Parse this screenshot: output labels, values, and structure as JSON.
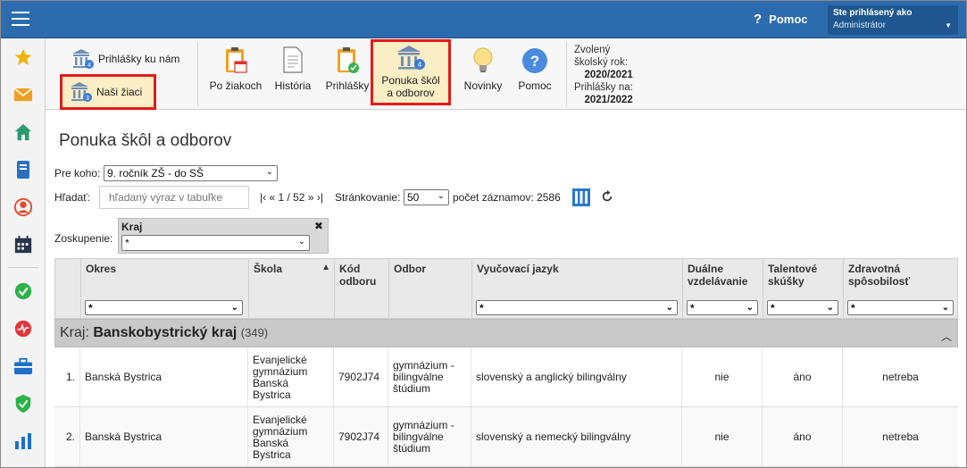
{
  "topbar": {
    "help_label": "Pomoc",
    "user_line1": "Ste prihlásený ako",
    "user_line2": "Administrátor",
    "bar_color": "#2c6bae"
  },
  "sidebar": {
    "items": [
      {
        "icon": "star-icon"
      },
      {
        "icon": "envelope-icon"
      },
      {
        "icon": "home-icon"
      },
      {
        "icon": "book-icon"
      },
      {
        "icon": "person-icon"
      },
      {
        "icon": "calendar-icon"
      },
      {
        "icon": "check-circle-icon"
      },
      {
        "icon": "pulse-icon"
      },
      {
        "icon": "briefcase-icon"
      },
      {
        "icon": "shield-icon"
      },
      {
        "icon": "bar-chart-icon"
      }
    ]
  },
  "ribbon": {
    "prihlasky_ku_nam": "Prihlášky ku nám",
    "nasi_ziaci": "Naši žiaci",
    "po_ziakoch": "Po žiakoch",
    "historia": "História",
    "prihlasky": "Prihlášky",
    "ponuka_line1": "Ponuka škôl",
    "ponuka_line2": "a odborov",
    "novinky": "Novinky",
    "pomoc": "Pomoc",
    "info_l1": "Zvolený",
    "info_l2": "školský rok:",
    "info_l3": "2020/2021",
    "info_l4": "Prihlášky na:",
    "info_l5": "2021/2022",
    "badge_prihlasky_ku_nam": "4",
    "badge_nasi_ziaci": "3",
    "badge_ponuka": "4"
  },
  "main": {
    "title": "Ponuka škôl a odborov",
    "pre_koho_label": "Pre koho:",
    "pre_koho_value": "9. ročník ZŠ - do SŠ",
    "hladat_label": "Hľadať:",
    "search_placeholder": "hľadaný výraz v tabuľke",
    "pager": "|‹ « 1 / 52 » ›|",
    "strankovanie_label": "Stránkovanie:",
    "strankovanie_value": "50",
    "pocet_label": "počet záznamov: 2586",
    "zoskupenie_label": "Zoskupenie:",
    "group_title": "Kraj",
    "group_close": "✖",
    "group_value": "*"
  },
  "table": {
    "headers": {
      "okres": "Okres",
      "skola": "Škola",
      "kod_line1": "Kód",
      "kod_line2": "odboru",
      "odbor": "Odbor",
      "jazyk": "Vyučovací jazyk",
      "dualne_line1": "Duálne",
      "dualne_line2": "vzdelávanie",
      "talent_line1": "Talentové",
      "talent_line2": "skúšky",
      "zdrav_line1": "Zdravotná",
      "zdrav_line2": "spôsobilosť"
    },
    "sort_indicator": "▲",
    "filter_value": "*",
    "group": {
      "label": "Kraj: ",
      "name": "Banskobystrický kraj",
      "count": "(349)"
    },
    "rows": [
      {
        "idx": "1.",
        "okres": "Banská Bystrica",
        "skola": "Evanjelické gymnázium Banská Bystrica",
        "kod": "7902J74",
        "odbor": "gymnázium - bilingválne štúdium",
        "jazyk": "slovenský a anglický bilingválny",
        "dualne": "nie",
        "talent": "áno",
        "zdrav": "netreba"
      },
      {
        "idx": "2.",
        "okres": "Banská Bystrica",
        "skola": "Evanjelické gymnázium Banská Bystrica",
        "kod": "7902J74",
        "odbor": "gymnázium - bilingválne štúdium",
        "jazyk": "slovenský a nemecký bilingválny",
        "dualne": "nie",
        "talent": "áno",
        "zdrav": "netreba"
      }
    ]
  }
}
